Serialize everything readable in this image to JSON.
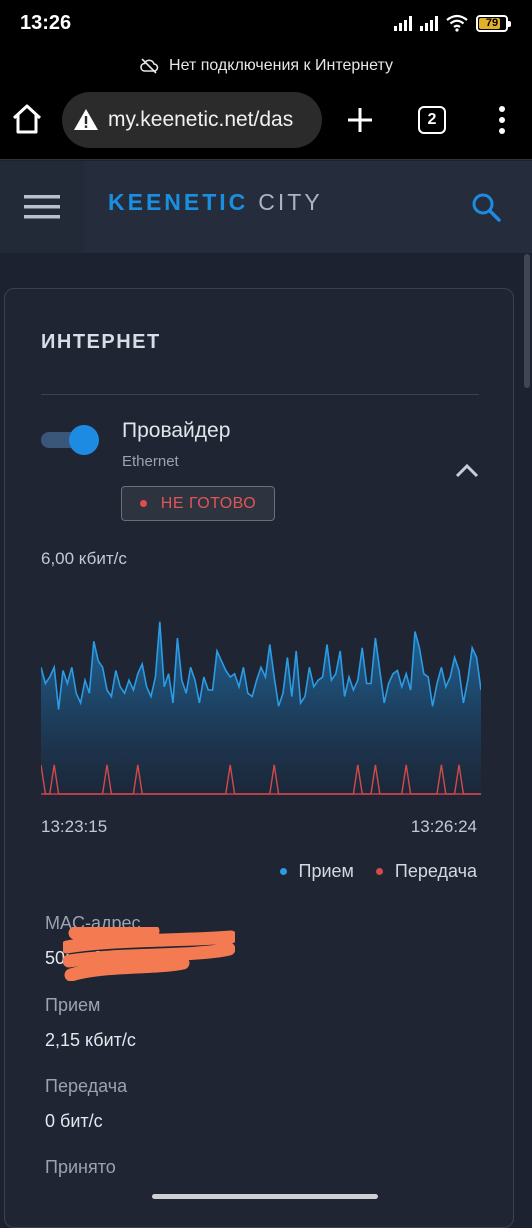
{
  "status_bar": {
    "time": "13:26",
    "battery": "79"
  },
  "offline_banner": {
    "text": "Нет подключения к Интернету"
  },
  "browser": {
    "url": "my.keenetic.net/das",
    "tab_count": "2"
  },
  "app": {
    "brand": "KEENETIC",
    "model": "CITY"
  },
  "internet_card": {
    "title": "ИНТЕРНЕТ",
    "provider": {
      "name": "Провайдер",
      "type": "Ethernet",
      "enabled": true,
      "status": "НЕ ГОТОВО"
    },
    "chart_max_label": "6,00 кбит/с",
    "time_start": "13:23:15",
    "time_end": "13:26:24",
    "legend": {
      "rx": "Прием",
      "tx": "Передача"
    },
    "stats": [
      {
        "label": "MAC-адрес",
        "value": "50:…:00:15"
      },
      {
        "label": "Прием",
        "value": "2,15 кбит/с"
      },
      {
        "label": "Передача",
        "value": "0 бит/с"
      },
      {
        "label": "Принято",
        "value": ""
      }
    ]
  },
  "colors": {
    "accent": "#1e8be3",
    "rx_series": "#2b9be4",
    "tx_series": "#d24a4a",
    "error": "#e05555"
  },
  "chart_data": {
    "type": "area",
    "title": "",
    "ylabel": "",
    "ymax_label": "6,00 кбит/с",
    "ylim": [
      0,
      6
    ],
    "x_range": [
      "13:23:15",
      "13:26:24"
    ],
    "series": [
      {
        "name": "Прием",
        "values": [
          3.9,
          3.4,
          3.6,
          3.9,
          2.6,
          3.8,
          3.4,
          3.9,
          3.1,
          2.8,
          3.5,
          3.1,
          4.7,
          4.1,
          3.9,
          3.2,
          3.0,
          3.8,
          3.3,
          3.1,
          3.5,
          3.2,
          3.7,
          4.0,
          3.3,
          3.0,
          3.6,
          5.3,
          3.3,
          3.7,
          2.8,
          4.8,
          3.5,
          3.1,
          3.9,
          3.5,
          2.8,
          3.6,
          3.2,
          3.2,
          4.4,
          4.1,
          3.8,
          3.6,
          3.7,
          3.3,
          3.9,
          3.1,
          3.0,
          3.5,
          3.9,
          3.6,
          4.6,
          3.6,
          2.7,
          3.1,
          4.2,
          3.0,
          4.4,
          2.8,
          3.0,
          3.9,
          3.3,
          3.5,
          3.6,
          4.6,
          3.5,
          3.7,
          4.4,
          3.0,
          3.6,
          3.2,
          3.5,
          4.5,
          3.4,
          3.4,
          4.8,
          3.8,
          2.8,
          3.4,
          3.7,
          3.8,
          3.3,
          3.7,
          3.2,
          5.0,
          4.5,
          3.7,
          3.6,
          2.7,
          3.4,
          3.9,
          3.3,
          3.6,
          4.2,
          3.8,
          2.8,
          3.5,
          4.5,
          4.2,
          3.2
        ]
      },
      {
        "name": "Передача",
        "values": [
          0.9,
          0,
          0,
          0.9,
          0,
          0,
          0,
          0,
          0,
          0,
          0,
          0,
          0,
          0,
          0,
          0.9,
          0,
          0,
          0,
          0,
          0,
          0,
          0.9,
          0,
          0,
          0,
          0,
          0,
          0,
          0,
          0,
          0,
          0,
          0,
          0,
          0,
          0,
          0,
          0,
          0,
          0,
          0,
          0,
          0.9,
          0,
          0,
          0,
          0,
          0,
          0,
          0,
          0,
          0,
          0.9,
          0,
          0,
          0,
          0,
          0,
          0,
          0,
          0,
          0,
          0,
          0,
          0,
          0,
          0,
          0,
          0,
          0,
          0,
          0.9,
          0,
          0,
          0,
          0.9,
          0,
          0,
          0,
          0,
          0,
          0,
          0.9,
          0,
          0,
          0,
          0,
          0,
          0,
          0,
          0.9,
          0,
          0,
          0,
          0.9,
          0,
          0,
          0,
          0,
          0
        ]
      }
    ]
  }
}
